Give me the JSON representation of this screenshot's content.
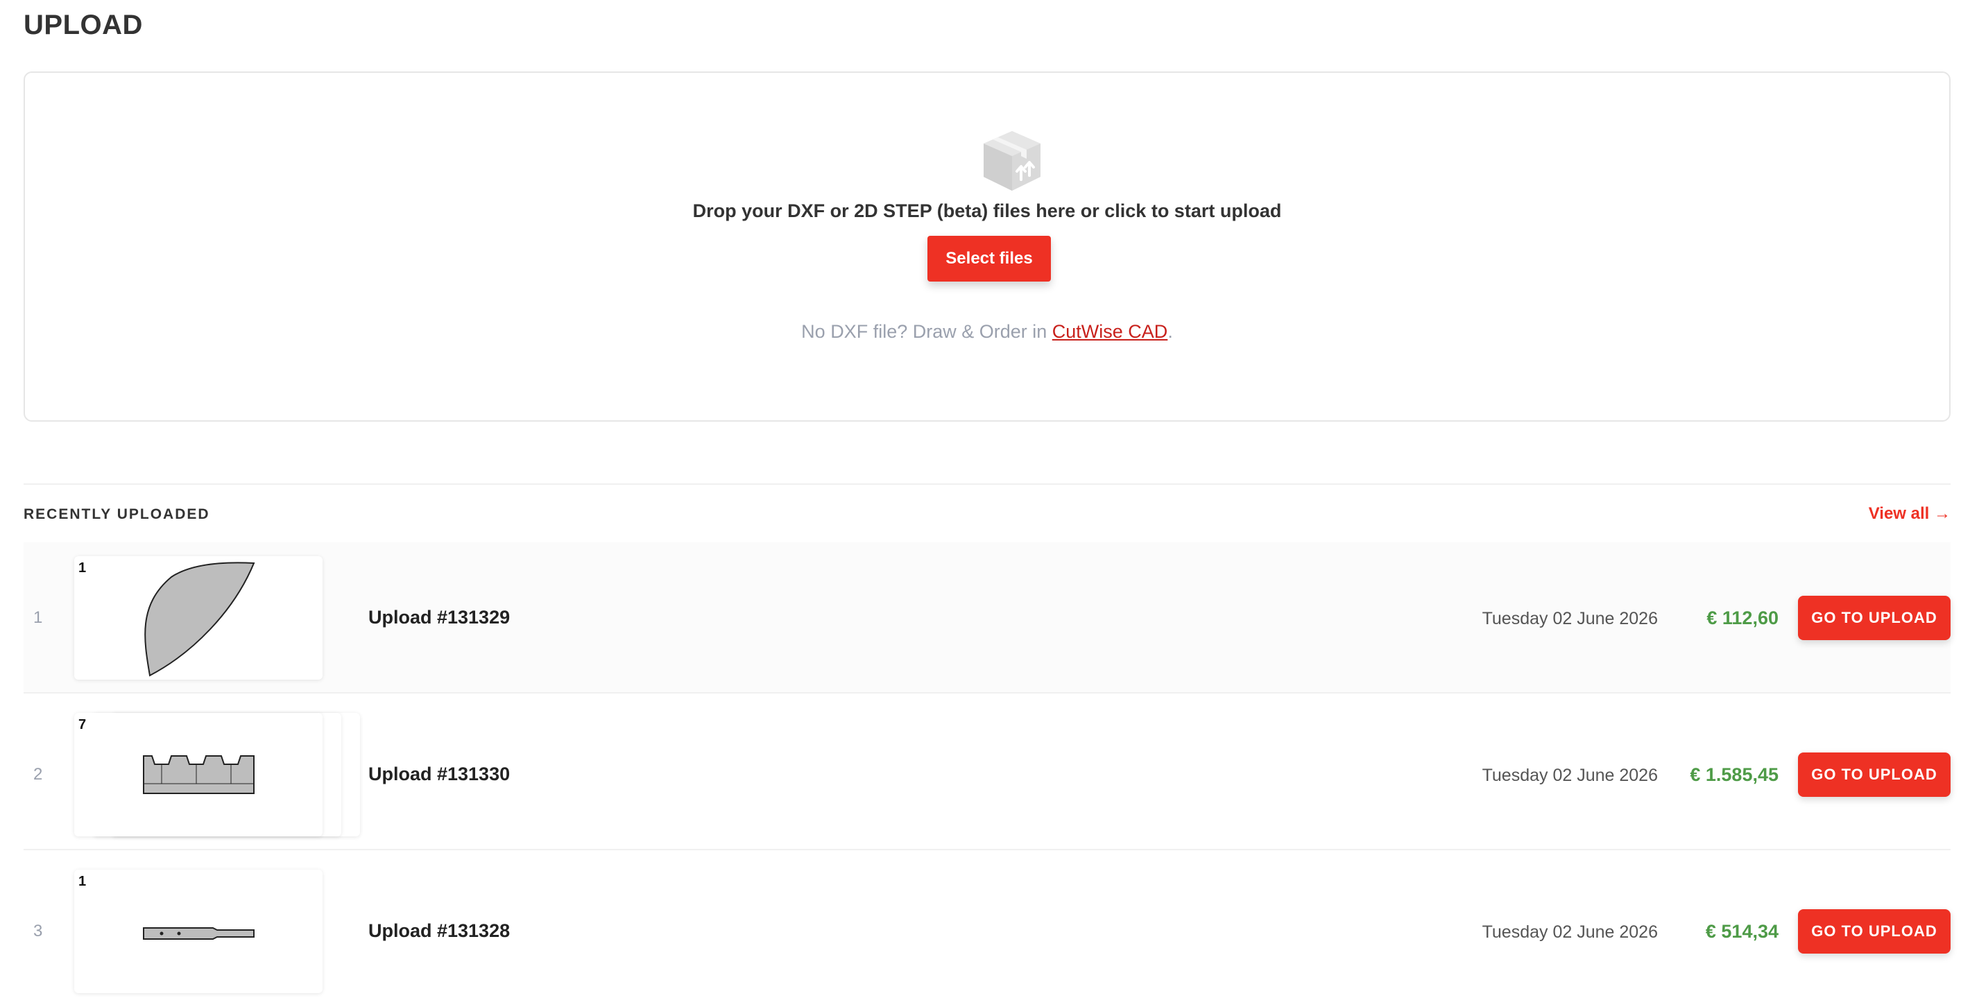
{
  "page": {
    "title": "UPLOAD"
  },
  "dropzone": {
    "instruction": "Drop your DXF or 2D STEP (beta) files here or click to start upload",
    "select_label": "Select files",
    "no_dxf_prefix": "No DXF file? Draw & Order in ",
    "cad_link": "CutWise CAD",
    "no_dxf_suffix": "."
  },
  "recent": {
    "title": "RECENTLY UPLOADED",
    "view_all": "View all →",
    "items": [
      {
        "index": "1",
        "count": "1",
        "name": "Upload #131329",
        "date": "Tuesday 02 June 2026",
        "price": "€ 112,60",
        "action": "GO TO UPLOAD"
      },
      {
        "index": "2",
        "count": "7",
        "name": "Upload #131330",
        "date": "Tuesday 02 June 2026",
        "price": "€ 1.585,45",
        "action": "GO TO UPLOAD"
      },
      {
        "index": "3",
        "count": "1",
        "name": "Upload #131328",
        "date": "Tuesday 02 June 2026",
        "price": "€ 514,34",
        "action": "GO TO UPLOAD"
      }
    ]
  },
  "colors": {
    "accent": "#ee3124",
    "price": "#4e9b47",
    "muted": "#9aa0ad"
  },
  "icons": {
    "dropzone": "box-upload-icon"
  }
}
